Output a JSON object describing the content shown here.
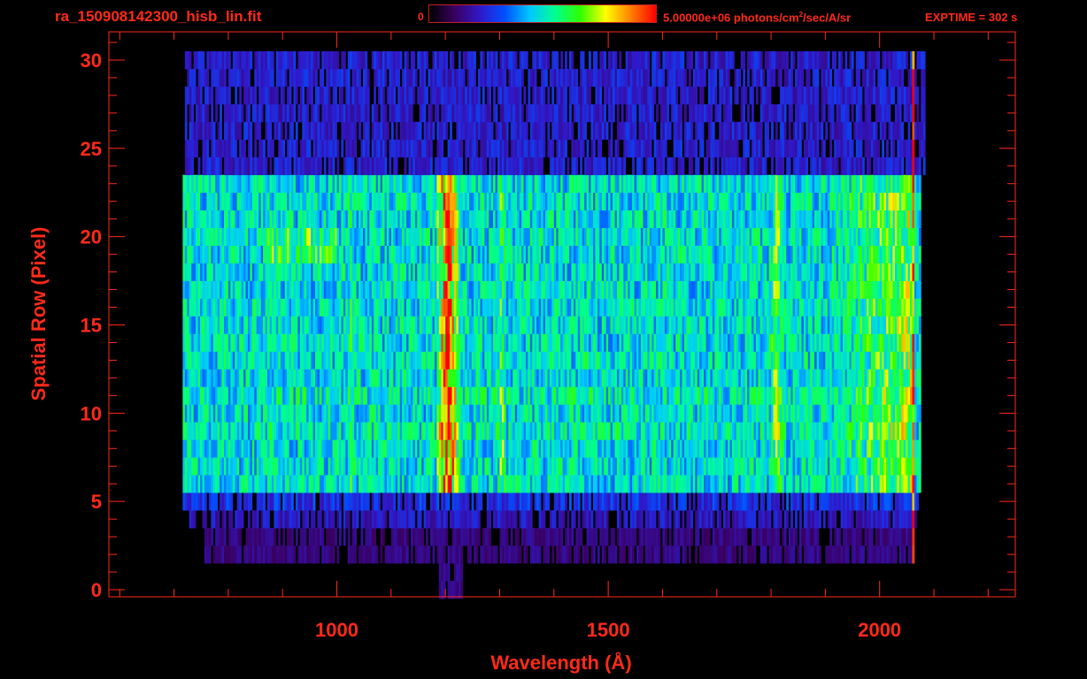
{
  "header": {
    "filename": "ra_150908142300_hisb_lin.fit",
    "colorbar_min": "0",
    "colorbar_max_value": "5.00000e+06 photons/cm",
    "colorbar_max_exp": "2",
    "colorbar_max_units": "/sec/A/sr",
    "exptime": "EXPTIME = 302 s"
  },
  "colors": {
    "axis": "#ff2a1a",
    "background": "#000000",
    "colormap": [
      "#000000",
      "#3a0060",
      "#3018c8",
      "#0050ff",
      "#00c8ff",
      "#00ff90",
      "#30ff00",
      "#ffff00",
      "#ff8000",
      "#ff0000"
    ]
  },
  "chart_data": {
    "type": "heatmap",
    "title": "",
    "xlabel": "Wavelength (Å)",
    "ylabel": "Spatial Row (Pixel)",
    "xlim": [
      580,
      2250
    ],
    "ylim": [
      -0.4,
      31.6
    ],
    "x_ticks": [
      1000,
      1500,
      2000
    ],
    "y_ticks": [
      0,
      5,
      10,
      15,
      20,
      25,
      30
    ],
    "x_minor_step": 100,
    "y_minor_step": 1,
    "colorbar_range": [
      0,
      5000000
    ],
    "colorbar_units": "photons/cm^2/sec/A/sr",
    "rows": [
      0,
      30
    ],
    "coverage": [
      {
        "rows": [
          0,
          1
        ],
        "x": [
          1190,
          1230
        ],
        "level": 0.15
      },
      {
        "rows": [
          2,
          3
        ],
        "x": [
          755,
          2065
        ],
        "level": 0.15
      },
      {
        "rows": [
          4,
          4
        ],
        "x": [
          730,
          2070
        ],
        "level": 0.22
      },
      {
        "rows": [
          5,
          5
        ],
        "x": [
          715,
          2070
        ],
        "level": 0.28
      },
      {
        "rows": [
          6,
          23
        ],
        "x": [
          715,
          2075
        ],
        "level": 0.5
      },
      {
        "rows": [
          24,
          30
        ],
        "x": [
          720,
          2085
        ],
        "level": 0.24
      }
    ],
    "source": {
      "rows": [
        6,
        23
      ],
      "x": [
        870,
        2065
      ],
      "continuum_level": 0.5,
      "top_edge_x": [
        800,
        870
      ],
      "emission_lines": [
        {
          "x": 1025,
          "width": 18,
          "level": 0.58
        },
        {
          "x": 1205,
          "width": 22,
          "level": 0.95
        },
        {
          "x": 1304,
          "width": 14,
          "level": 0.66
        },
        {
          "x": 1810,
          "width": 20,
          "level": 0.68
        },
        {
          "x": 2045,
          "width": 25,
          "level": 0.7
        }
      ]
    },
    "edge_line": {
      "x": 2063,
      "level": 0.95
    }
  }
}
